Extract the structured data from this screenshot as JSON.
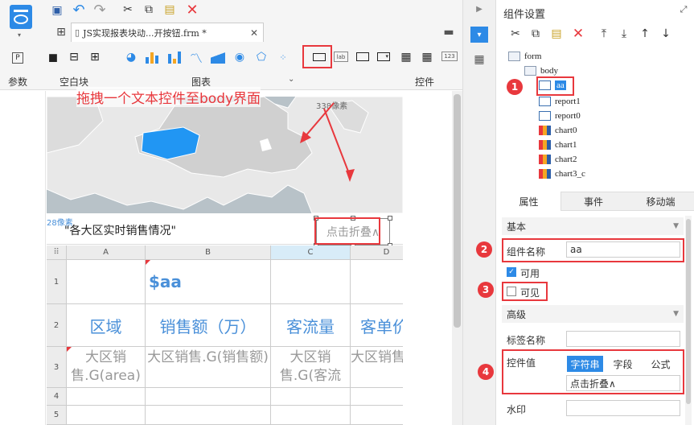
{
  "toolbar": {
    "tab_title": "JS实现报表块动...开按钮.frm *",
    "group_param": "参数",
    "group_blank": "空白块",
    "group_chart": "图表",
    "group_widget": "控件"
  },
  "canvas": {
    "annotation": "拖拽一个文本控件至body界面",
    "map_watermark": "338像素",
    "widget_label": "\"各大区实时销售情况\"",
    "widget_watermark": "28像素",
    "button_text": "点击折叠∧"
  },
  "sheet": {
    "col_headers": [
      "A",
      "B",
      "C",
      "D"
    ],
    "row_headers": [
      "1",
      "2",
      "3",
      "4",
      "5"
    ],
    "param_cell": "$aa",
    "headers": [
      "区域",
      "销售额（万）",
      "客流量",
      "客单价"
    ],
    "data_row": [
      "大区销售.G(area)",
      "大区销售.G(销售额)",
      "大区销售.G(客流量)",
      "大区销售.G(客单价)"
    ]
  },
  "right": {
    "panel_title": "组件设置",
    "tree": [
      "form",
      "body",
      "aa",
      "report1",
      "report0",
      "chart0",
      "chart1",
      "chart2",
      "chart3_c"
    ],
    "tabs": [
      "属性",
      "事件",
      "移动端"
    ],
    "section_basic": "基本",
    "name_label": "组件名称",
    "name_value": "aa",
    "enabled_label": "可用",
    "visible_label": "可见",
    "section_adv": "高级",
    "tag_label": "标签名称",
    "value_label": "控件值",
    "value_types": [
      "字符串",
      "字段",
      "公式"
    ],
    "value_text": "点击折叠∧",
    "watermark_label": "水印"
  },
  "badges": [
    "1",
    "2",
    "3",
    "4"
  ],
  "colors": {
    "accent": "#2d8ae6",
    "annotation_red": "#e8383d",
    "map_blue": "#2196f3",
    "header_blue": "#4a90d9"
  }
}
